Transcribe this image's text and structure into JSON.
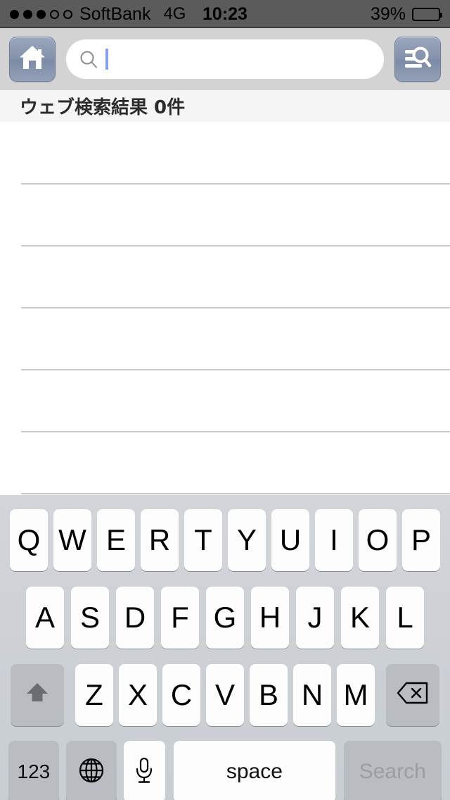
{
  "status_bar": {
    "signal_dots_filled": 3,
    "signal_dots_total": 5,
    "carrier": "SoftBank",
    "network": "4G",
    "time": "10:23",
    "battery_percent_label": "39%",
    "battery_level": 39
  },
  "nav_bar": {
    "home_button_icon": "home-icon",
    "search_results_button_icon": "search-list-icon",
    "search_field": {
      "icon": "search-icon",
      "value": "",
      "placeholder": "",
      "caret_color": "#8a9ff0",
      "focused": true
    }
  },
  "results_header": {
    "label": "ウェブ検索結果 0件"
  },
  "results_list": {
    "row_count": 6,
    "items": []
  },
  "keyboard": {
    "layout": "qwerty-uppercase",
    "row1": [
      "Q",
      "W",
      "E",
      "R",
      "T",
      "Y",
      "U",
      "I",
      "O",
      "P"
    ],
    "row2": [
      "A",
      "S",
      "D",
      "F",
      "G",
      "H",
      "J",
      "K",
      "L"
    ],
    "row3": [
      "Z",
      "X",
      "C",
      "V",
      "B",
      "N",
      "M"
    ],
    "shift_icon": "shift-arrow-icon",
    "backspace_icon": "backspace-icon",
    "numbers_key_label": "123",
    "globe_icon": "globe-icon",
    "microphone_icon": "microphone-icon",
    "space_key_label": "space",
    "return_key_label": "Search",
    "return_key_enabled": false
  },
  "colors": {
    "status_bar_bg": "#5b5b5b",
    "nav_bar_bg": "#d3d3d3",
    "header_bg": "#f5f5f5",
    "keyboard_bg": "#cdd1d6",
    "key_white": "#fdfdfd",
    "key_gray": "#b9bdc2",
    "separator": "#c8c8c8",
    "button_blue_gray": "#8492ab"
  }
}
